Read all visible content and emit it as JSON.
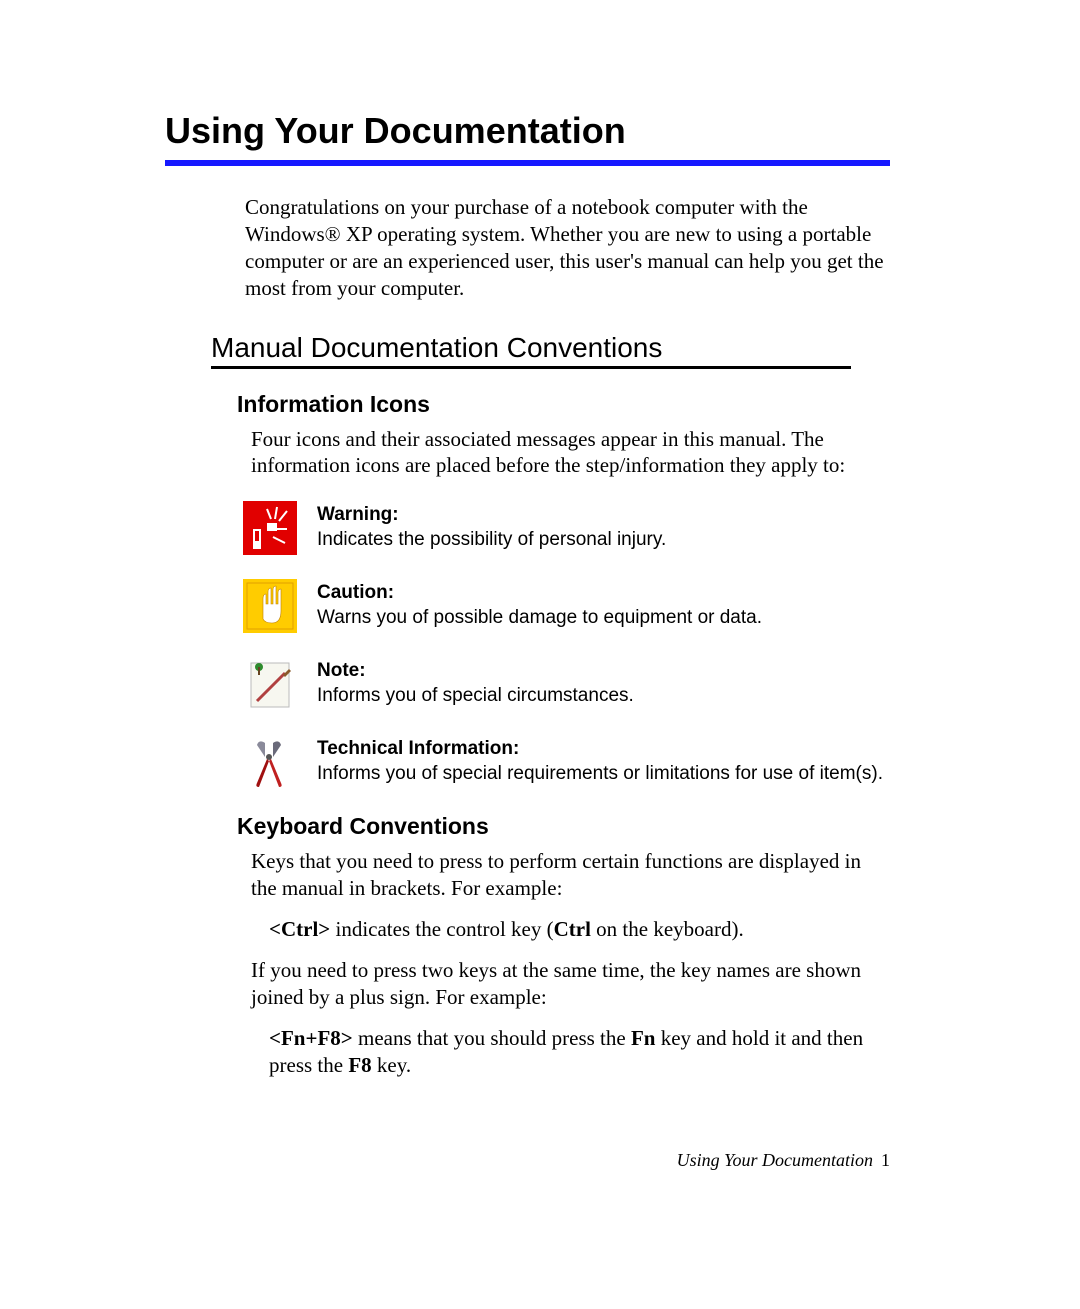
{
  "chapter_title": "Using Your Documentation",
  "intro": "Congratulations on your purchase of a notebook computer with the Windows® XP operating system. Whether you are new to using a portable computer or are an experienced user, this user's manual can help you get the most from your computer.",
  "section_heading": "Manual Documentation Conventions",
  "info_icons": {
    "heading": "Information Icons",
    "intro": "Four icons and their associated messages appear in this manual. The information icons are placed before the step/information they apply to:",
    "items": [
      {
        "label": "Warning:",
        "desc": "Indicates the possibility of personal injury."
      },
      {
        "label": "Caution:",
        "desc": "Warns you of possible damage to equipment or data."
      },
      {
        "label": "Note:",
        "desc": "Informs you of special circumstances."
      },
      {
        "label": "Technical Information:",
        "desc": "Informs you of special requirements or limitations for use of item(s)."
      }
    ]
  },
  "keyboard": {
    "heading": "Keyboard Conventions",
    "p1": "Keys that you need to press to perform certain functions are displayed in the manual in brackets. For example:",
    "ex1_key": "<Ctrl>",
    "ex1_mid": " indicates the control key (",
    "ex1_bold": "Ctrl",
    "ex1_end": " on the keyboard).",
    "p2": "If you need to press two keys at the same time, the key names are shown joined by a plus sign. For example:",
    "ex2_key": "<Fn+F8>",
    "ex2_a": " means that you should press the ",
    "ex2_fn": "Fn",
    "ex2_b": " key and hold it and then press the ",
    "ex2_f8": "F8",
    "ex2_c": " key."
  },
  "footer": {
    "text": "Using Your Documentation",
    "page": "1"
  }
}
